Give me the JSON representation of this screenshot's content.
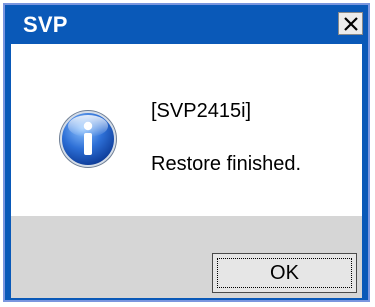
{
  "window": {
    "title": "SVP"
  },
  "message": {
    "title": "[SVP2415i]",
    "body": "Restore finished."
  },
  "buttons": {
    "ok_label": "OK"
  },
  "icons": {
    "close": "close-icon",
    "info": "info-icon"
  },
  "colors": {
    "titlebar": "#0a59b8",
    "footer": "#d6d6d6"
  }
}
